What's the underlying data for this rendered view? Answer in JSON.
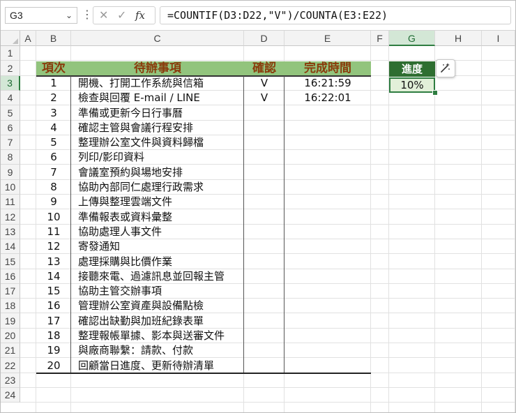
{
  "formula_bar": {
    "name_box": "G3",
    "dropdown_glyph": "⌄",
    "more_glyph": "⋮",
    "cancel_glyph": "✕",
    "enter_glyph": "✓",
    "fx_label": "fx",
    "formula": "=COUNTIF(D3:D22,\"V\")/COUNTA(E3:E22)"
  },
  "columns": [
    "A",
    "B",
    "C",
    "D",
    "E",
    "F",
    "G",
    "H",
    "I"
  ],
  "rows": [
    "1",
    "2",
    "3",
    "4",
    "5",
    "6",
    "7",
    "8",
    "9",
    "10",
    "11",
    "12",
    "13",
    "14",
    "15",
    "16",
    "17",
    "18",
    "19",
    "20",
    "21",
    "22",
    "23",
    "24"
  ],
  "selected_cell": "G3",
  "table": {
    "headers": [
      "項次",
      "待辦事項",
      "確認",
      "完成時間"
    ],
    "rows": [
      {
        "no": "1",
        "task": "開機、打開工作系統與信箱",
        "confirm": "V",
        "time": "16:21:59"
      },
      {
        "no": "2",
        "task": "檢查與回覆 E-mail / LINE",
        "confirm": "V",
        "time": "16:22:01"
      },
      {
        "no": "3",
        "task": "準備或更新今日行事曆",
        "confirm": "",
        "time": ""
      },
      {
        "no": "4",
        "task": "確認主管與會議行程安排",
        "confirm": "",
        "time": ""
      },
      {
        "no": "5",
        "task": "整理辦公室文件與資料歸檔",
        "confirm": "",
        "time": ""
      },
      {
        "no": "6",
        "task": "列印/影印資料",
        "confirm": "",
        "time": ""
      },
      {
        "no": "7",
        "task": "會議室預約與場地安排",
        "confirm": "",
        "time": ""
      },
      {
        "no": "8",
        "task": "協助內部同仁處理行政需求",
        "confirm": "",
        "time": ""
      },
      {
        "no": "9",
        "task": "上傳與整理雲端文件",
        "confirm": "",
        "time": ""
      },
      {
        "no": "10",
        "task": "準備報表或資料彙整",
        "confirm": "",
        "time": ""
      },
      {
        "no": "11",
        "task": "協助處理人事文件",
        "confirm": "",
        "time": ""
      },
      {
        "no": "12",
        "task": "寄發通知",
        "confirm": "",
        "time": ""
      },
      {
        "no": "13",
        "task": "處理採購與比價作業",
        "confirm": "",
        "time": ""
      },
      {
        "no": "14",
        "task": "接聽來電、過濾訊息並回報主管",
        "confirm": "",
        "time": ""
      },
      {
        "no": "15",
        "task": "協助主管交辦事項",
        "confirm": "",
        "time": ""
      },
      {
        "no": "16",
        "task": "管理辦公室資產與設備點檢",
        "confirm": "",
        "time": ""
      },
      {
        "no": "17",
        "task": "確認出缺勤與加班紀錄表單",
        "confirm": "",
        "time": ""
      },
      {
        "no": "18",
        "task": "整理報帳單據、影本與送審文件",
        "confirm": "",
        "time": ""
      },
      {
        "no": "19",
        "task": "與廠商聯繫：請款、付款",
        "confirm": "",
        "time": ""
      },
      {
        "no": "20",
        "task": "回顧當日進度、更新待辦清單",
        "confirm": "",
        "time": ""
      }
    ]
  },
  "progress": {
    "label": "進度",
    "value": "10%"
  },
  "quick_action_icon": "sparkle-wand-icon",
  "colors": {
    "header_fill": "#92c47d",
    "header_text": "#8a3b0c",
    "progress_header_fill": "#2e6e31",
    "progress_value_fill": "#e2f0d9",
    "selection_accent": "#2e7d41"
  }
}
